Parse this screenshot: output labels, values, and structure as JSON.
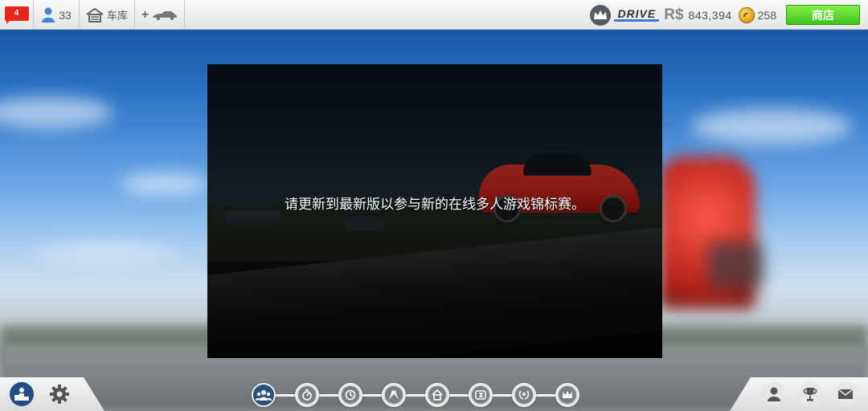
{
  "topbar": {
    "notification_count": "4",
    "friends_count": "33",
    "garage_label": "车库",
    "add_car_label": "+"
  },
  "currency": {
    "drive_label": "DRIVE",
    "rs_label": "R$",
    "rs_value": "843,394",
    "gold_value": "258",
    "shop_label": "商店"
  },
  "message": "请更新到最新版以参与新的在线多人游戏锦标赛。",
  "mode_nav": [
    {
      "icon": "group-icon",
      "active": true
    },
    {
      "icon": "stopwatch-icon",
      "active": false
    },
    {
      "icon": "timer-icon",
      "active": false
    },
    {
      "icon": "checkered-flags-icon",
      "active": false
    },
    {
      "icon": "home-icon",
      "active": false
    },
    {
      "icon": "r3-badge-icon",
      "active": false
    },
    {
      "icon": "laurel-wreath-icon",
      "active": false
    },
    {
      "icon": "crown-icon",
      "active": false
    }
  ],
  "bottom_left": [
    "podium-icon",
    "gear-icon"
  ],
  "bottom_right": [
    "profile-icon",
    "trophy-icon",
    "mail-icon"
  ],
  "colors": {
    "accent_blue": "#214e86",
    "shop_green": "#3cc21a",
    "flag_red": "#e8261e"
  }
}
